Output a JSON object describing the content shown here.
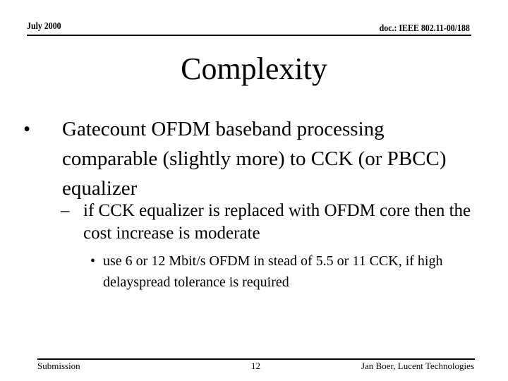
{
  "header": {
    "date": "July 2000",
    "doc_id": "doc.: IEEE 802.11-00/188"
  },
  "slide": {
    "title": "Complexity",
    "bullets": [
      {
        "level": 1,
        "marker": "•",
        "text": "Gatecount OFDM baseband processing comparable (slightly more) to CCK (or PBCC) equalizer"
      },
      {
        "level": 2,
        "marker": "–",
        "text": "if CCK equalizer is replaced with OFDM core then the cost increase is moderate"
      },
      {
        "level": 3,
        "marker": "•",
        "text": "use 6 or 12 Mbit/s OFDM in stead of 5.5 or 11 CCK, if high delayspread tolerance is required"
      }
    ]
  },
  "footer": {
    "left": "Submission",
    "page_number": "12",
    "author": "Jan Boer, Lucent Technologies"
  }
}
